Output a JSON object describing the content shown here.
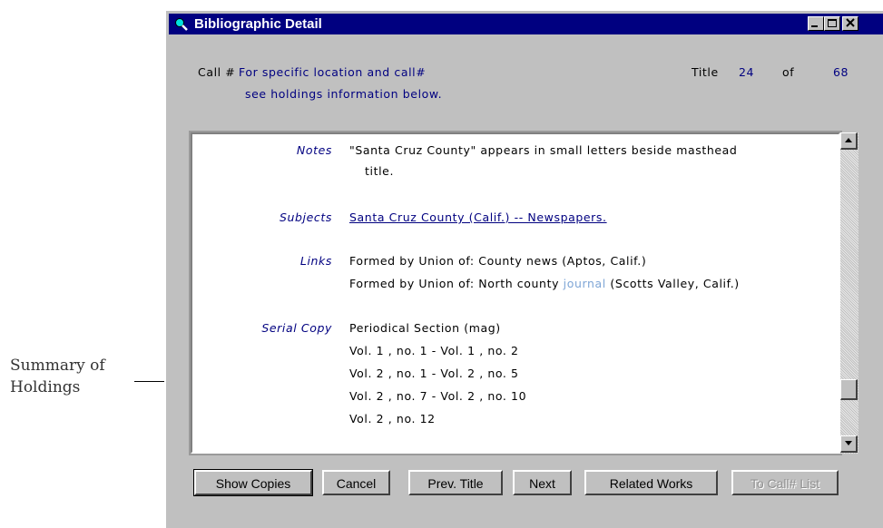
{
  "annotation": {
    "line1": "Summary of",
    "line2": "Holdings"
  },
  "window": {
    "title": "Bibliographic Detail",
    "icon": "magnifier-icon",
    "controls": [
      "minimize-icon",
      "maximize-icon",
      "close-icon"
    ]
  },
  "header": {
    "call_label": "Call #",
    "call_line1": "For specific location and call#",
    "call_line2": "see holdings information below.",
    "title_label": "Title",
    "current": "24",
    "of_label": "of",
    "total": "68"
  },
  "record": {
    "notes_label": "Notes",
    "notes_line1": "\"Santa Cruz County\" appears in small letters beside masthead",
    "notes_line2": "title.",
    "subjects_label": "Subjects",
    "subjects_value": "Santa Cruz County (Calif.) -- Newspapers.",
    "links_label": "Links",
    "links_line1": "Formed by Union of: County news (Aptos, Calif.)",
    "links_line2_a": "Formed by Union of: North county ",
    "links_line2_b": "journal",
    "links_line2_c": " (Scotts Valley, Calif.)",
    "serial_label": "Serial Copy",
    "serial_items": [
      "Periodical Section (mag)",
      "Vol. 1 , no. 1 - Vol. 1 , no. 2",
      "Vol. 2 , no. 1 - Vol. 2 , no. 5",
      "Vol. 2 , no. 7 - Vol. 2 , no. 10",
      "Vol. 2 , no. 12"
    ]
  },
  "buttons": {
    "show_copies": "Show Copies",
    "cancel": "Cancel",
    "prev_title": "Prev. Title",
    "next": "Next",
    "related_works": "Related Works",
    "to_call_list": "To Call# List"
  },
  "colors": {
    "titlebar": "#000080",
    "text_blue": "#000080",
    "window_gray": "#c0c0c0"
  }
}
